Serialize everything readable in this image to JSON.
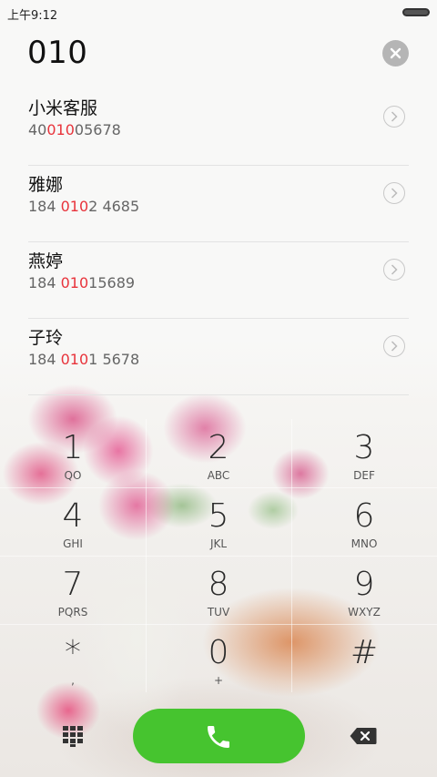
{
  "status_bar": {
    "time": "上午9:12"
  },
  "dialed_number": "010",
  "contacts": [
    {
      "name": "小米客服",
      "number_pre": "40",
      "number_match": "010",
      "number_post": "05678"
    },
    {
      "name": "雅娜",
      "number_pre": "184 ",
      "number_match": "010",
      "number_post": "2 4685"
    },
    {
      "name": "燕婷",
      "number_pre": "184 ",
      "number_match": "010",
      "number_post": "15689"
    },
    {
      "name": "子玲",
      "number_pre": "184 ",
      "number_match": "010",
      "number_post": "1 5678"
    }
  ],
  "keypad": [
    {
      "digit": "1",
      "letters": "QO"
    },
    {
      "digit": "2",
      "letters": "ABC"
    },
    {
      "digit": "3",
      "letters": "DEF"
    },
    {
      "digit": "4",
      "letters": "GHI"
    },
    {
      "digit": "5",
      "letters": "JKL"
    },
    {
      "digit": "6",
      "letters": "MNO"
    },
    {
      "digit": "7",
      "letters": "PQRS"
    },
    {
      "digit": "8",
      "letters": "TUV"
    },
    {
      "digit": "9",
      "letters": "WXYZ"
    },
    {
      "digit": "*",
      "letters": ","
    },
    {
      "digit": "0",
      "letters": "+"
    },
    {
      "digit": "#",
      "letters": ""
    }
  ],
  "colors": {
    "match_highlight": "#e8333b",
    "call_button": "#46c42f",
    "clear_button": "#b5b5b5"
  },
  "icons": {
    "clear": "close-icon",
    "contact_detail": "chevron-right-icon",
    "dialpad": "dialpad-grid-icon",
    "call": "phone-icon",
    "delete": "backspace-icon"
  }
}
